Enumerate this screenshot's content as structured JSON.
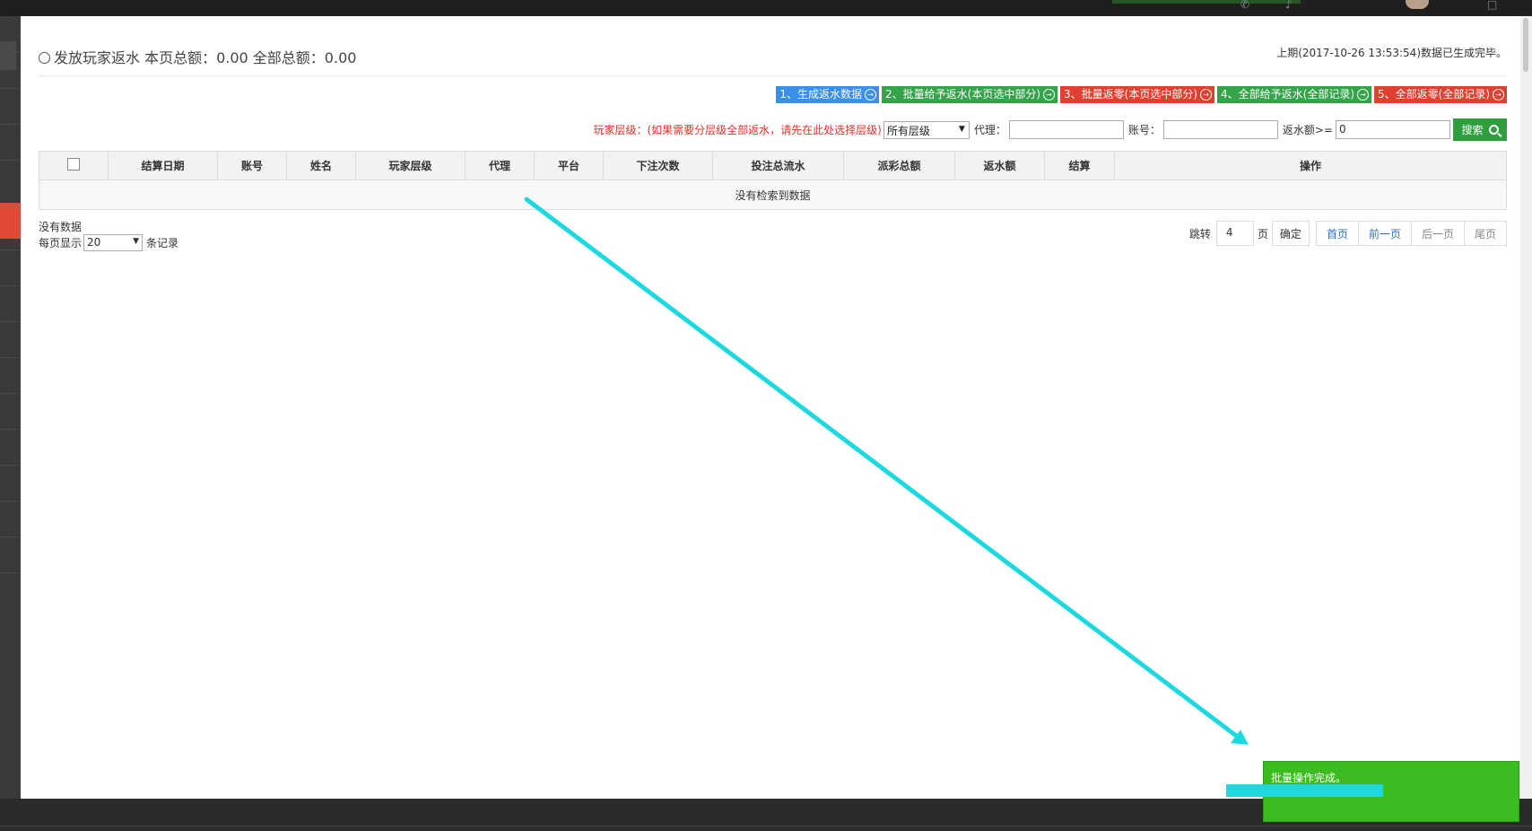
{
  "header": {
    "title": "发放玩家返水 本页总额：0.00 全部总额：0.00",
    "status": "上期(2017-10-26 13:53:54)数据已生成完毕。"
  },
  "actions": [
    {
      "label": "1、生成返水数据",
      "color": "#3b8fe6"
    },
    {
      "label": "2、批量给予返水(本页选中部分)",
      "color": "#35a34a"
    },
    {
      "label": "3、批量返零(本页选中部分)",
      "color": "#e04030"
    },
    {
      "label": "4、全部给予返水(全部记录)",
      "color": "#35a34a"
    },
    {
      "label": "5、全部返零(全部记录)",
      "color": "#e04030"
    }
  ],
  "filters": {
    "level_note": "玩家层级：(如果需要分层级全部返水，请先在此处选择层级)",
    "level_value": "所有层级",
    "agent_label": "代理：",
    "agent_value": "",
    "account_label": "账号：",
    "account_value": "",
    "rebate_label": "返水额>=",
    "rebate_value": "0",
    "search_label": "搜索"
  },
  "table": {
    "columns": [
      "结算日期",
      "账号",
      "姓名",
      "玩家层级",
      "代理",
      "平台",
      "下注次数",
      "投注总流水",
      "派彩总额",
      "返水额",
      "结算",
      "操作"
    ],
    "empty_message": "没有检索到数据"
  },
  "footer": {
    "no_data": "没有数据",
    "per_page_label": "每页显示",
    "per_page_value": "20",
    "records_label": "条记录"
  },
  "pager": {
    "jump_label": "跳转",
    "page_value": "4",
    "page_unit": "页",
    "confirm_label": "确定",
    "first": "首页",
    "prev": "前一页",
    "next": "后一页",
    "last": "尾页"
  },
  "toast": {
    "message": "批量操作完成。",
    "color": "#3bbd22"
  },
  "colors": {
    "primary_blue": "#3b8fe6",
    "success_green": "#35a34a",
    "danger_red": "#e04030",
    "annotation_cyan": "#1ed8df"
  }
}
